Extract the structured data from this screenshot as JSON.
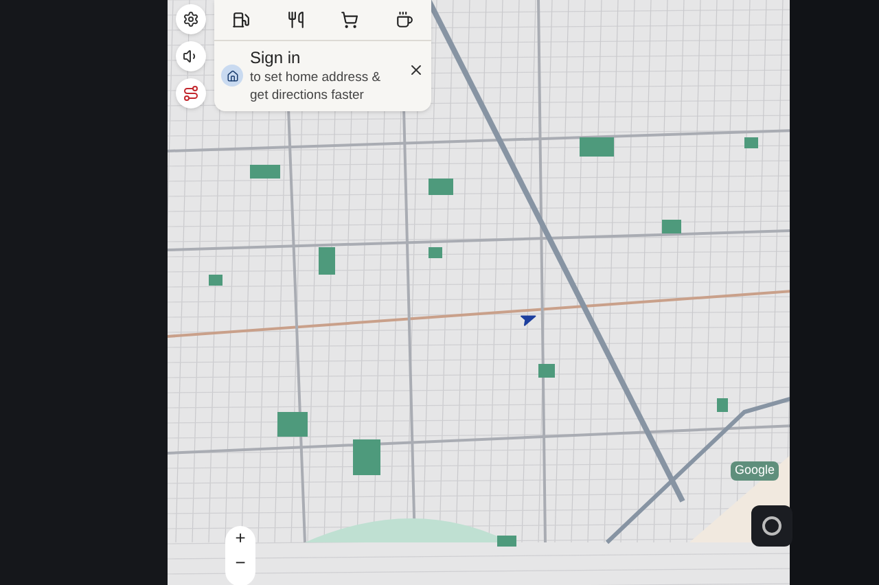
{
  "sign_in_card": {
    "title": "Sign in",
    "message": "to set home address & get directions faster"
  },
  "zoom_controls": {
    "zoom_in": "+",
    "zoom_out": "−"
  },
  "map": {
    "attribution": "Google"
  }
}
